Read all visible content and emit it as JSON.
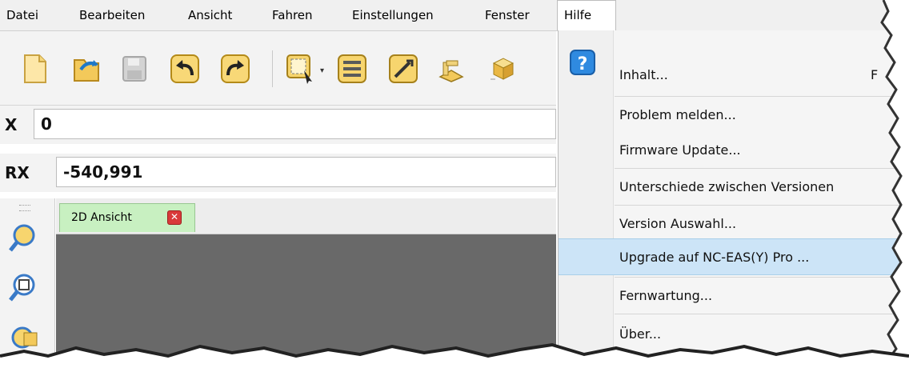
{
  "menubar": {
    "items": [
      {
        "label": "Datei"
      },
      {
        "label": "Bearbeiten"
      },
      {
        "label": "Ansicht"
      },
      {
        "label": "Fahren"
      },
      {
        "label": "Einstellungen"
      },
      {
        "label": "Fenster"
      },
      {
        "label": "Hilfe",
        "open": true
      }
    ]
  },
  "toolbar": {
    "icons": [
      "new-file-icon",
      "open-file-icon",
      "save-icon",
      "undo-icon",
      "redo-icon",
      "select-area-icon",
      "list-icon",
      "tool-icon",
      "machine-icon",
      "box-icon"
    ]
  },
  "coords": {
    "x": {
      "label": "X",
      "value": "0"
    },
    "rx": {
      "label": "RX",
      "value": "-540,991"
    }
  },
  "tabs": {
    "items": [
      {
        "label": "2D Ansicht",
        "active": true
      }
    ]
  },
  "help_menu": {
    "items": [
      {
        "label": "Inhalt...",
        "shortcut_partial": "F"
      },
      {
        "label": "Problem melden..."
      },
      {
        "label": "Firmware Update..."
      },
      {
        "label": "Unterschiede zwischen Versionen"
      },
      {
        "label": "Version Auswahl..."
      },
      {
        "label": "Upgrade auf NC-EAS(Y) Pro ...",
        "highlighted": true
      },
      {
        "label": "Fernwartung..."
      },
      {
        "label": "Über..."
      }
    ]
  },
  "colors": {
    "highlight": "#cce4f7",
    "tab_active": "#c8f0c1",
    "canvas": "#696969",
    "close": "#d93a3a"
  }
}
